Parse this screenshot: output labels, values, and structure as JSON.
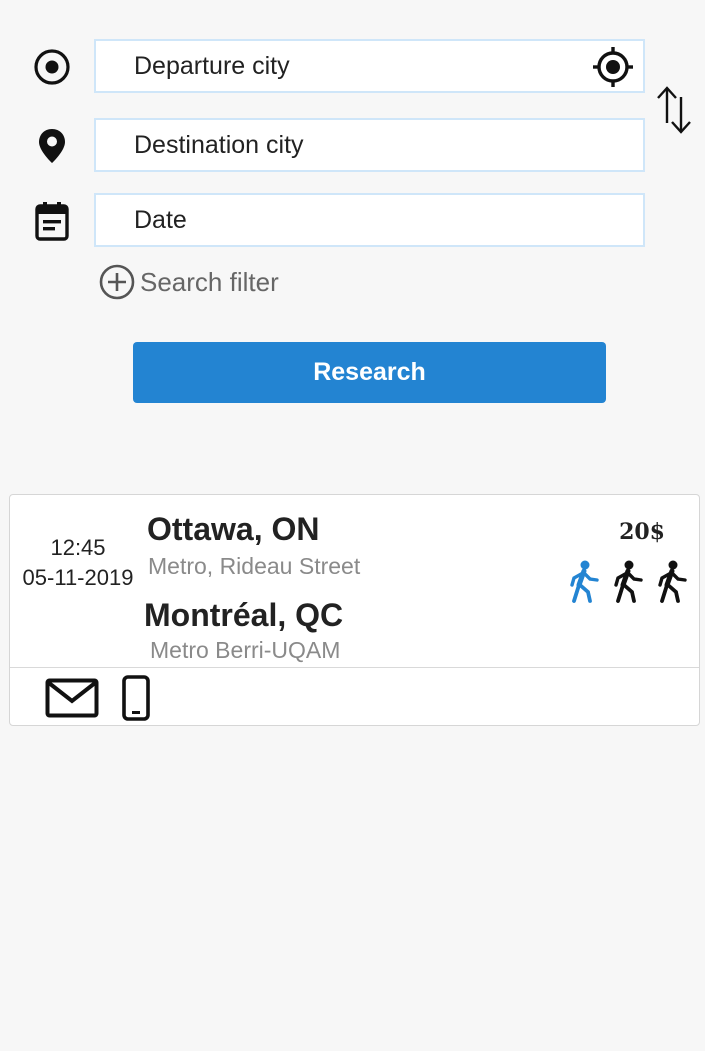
{
  "search": {
    "departure": {
      "placeholder": "Departure city",
      "value": ""
    },
    "destination": {
      "placeholder": "Destination city",
      "value": ""
    },
    "date": {
      "placeholder": "Date",
      "value": ""
    },
    "filter_label": "Search filter",
    "submit_label": "Research"
  },
  "icons": {
    "departure": "radio-target-icon",
    "locate": "gps-locate-icon",
    "swap": "swap-vertical-icon",
    "destination": "map-pin-icon",
    "date": "calendar-icon",
    "filter": "plus-circle-icon",
    "email": "envelope-icon",
    "phone": "smartphone-icon",
    "seat": "person-walking-icon"
  },
  "results": [
    {
      "time": "12:45",
      "date": "05-11-2019",
      "from": {
        "city": "Ottawa, ON",
        "stop": "Metro, Rideau Street"
      },
      "to": {
        "city": "Montréal, QC",
        "stop": "Metro Berri-UQAM"
      },
      "price": "20$",
      "seats_total": 3,
      "seats_taken": 1
    }
  ],
  "colors": {
    "accent": "#2384d2",
    "field_border": "#cfe6f9",
    "background": "#f7f7f7",
    "seat_taken": "#2384d2",
    "seat_free": "#111111"
  }
}
